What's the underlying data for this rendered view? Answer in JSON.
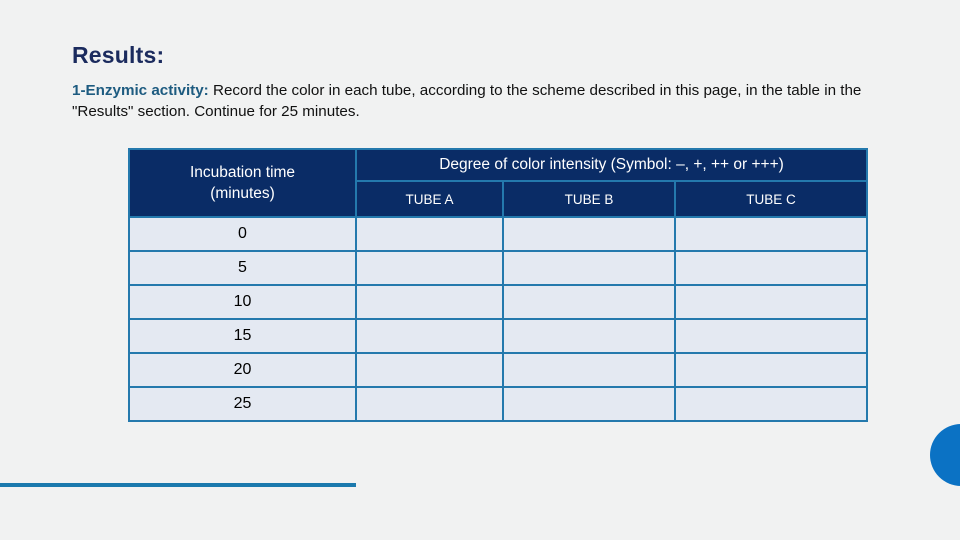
{
  "slide": {
    "title": "Results:",
    "intro": {
      "lead": "1-Enzymic activity:",
      "body": " Record the color in each tube, according to the scheme described in this page, in the table in the \"Results\" section. Continue for 25 minutes."
    }
  },
  "table": {
    "header": {
      "time_column": "Incubation time (minutes)",
      "time_column_line1": "Incubation time",
      "time_column_line2": "(minutes)",
      "group_header": "Degree of color intensity (Symbol: –, +, ++ or +++)",
      "sub_headers": [
        "TUBE A",
        "TUBE B",
        "TUBE C"
      ]
    },
    "rows": [
      {
        "time": "0",
        "tube_a": "",
        "tube_b": "",
        "tube_c": ""
      },
      {
        "time": "5",
        "tube_a": "",
        "tube_b": "",
        "tube_c": ""
      },
      {
        "time": "10",
        "tube_a": "",
        "tube_b": "",
        "tube_c": ""
      },
      {
        "time": "15",
        "tube_a": "",
        "tube_b": "",
        "tube_c": ""
      },
      {
        "time": "20",
        "tube_a": "",
        "tube_b": "",
        "tube_c": ""
      },
      {
        "time": "25",
        "tube_a": "",
        "tube_b": "",
        "tube_c": ""
      }
    ]
  },
  "decorations": {
    "accent_line_color": "#1b79ad",
    "accent_circle_color": "#0b72c4"
  },
  "colors": {
    "background": "#f1f2f2",
    "title": "#1b2b5e",
    "lead": "#1d5b80",
    "header_fill": "#0a2c66",
    "cell_fill": "#e4e9f2",
    "border": "#2479ad"
  }
}
